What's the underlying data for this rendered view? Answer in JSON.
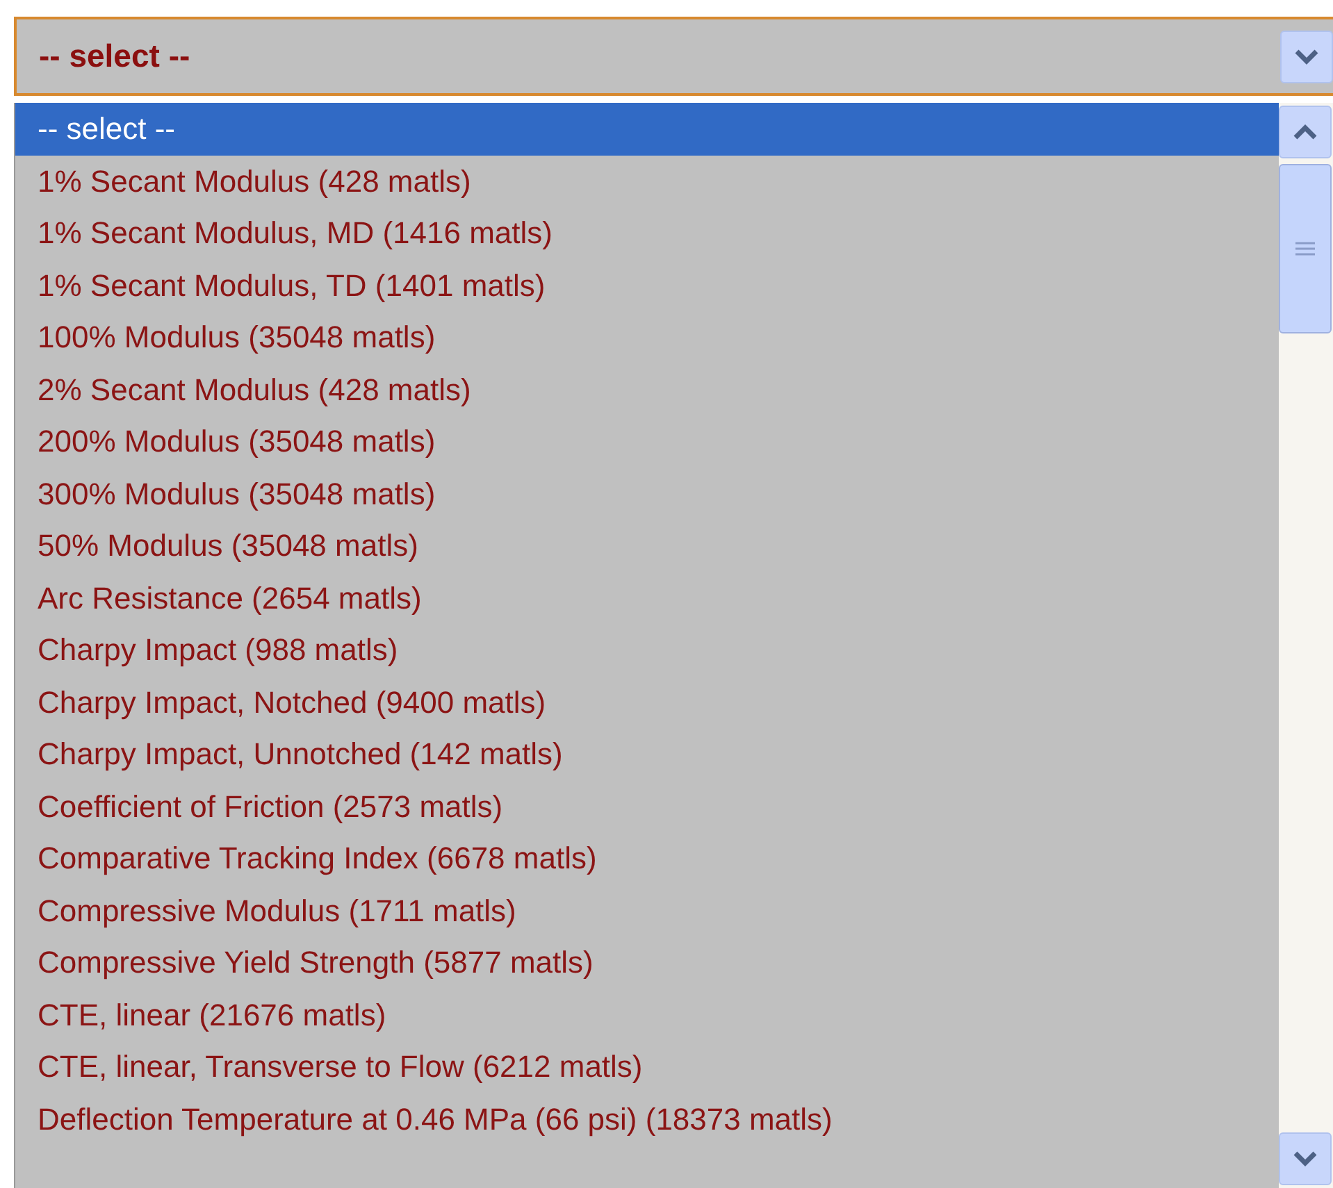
{
  "select": {
    "value": "-- select --"
  },
  "options": [
    {
      "label": "-- select --",
      "selected": true
    },
    {
      "label": "1% Secant Modulus (428 matls)",
      "selected": false
    },
    {
      "label": "1% Secant Modulus, MD (1416 matls)",
      "selected": false
    },
    {
      "label": "1% Secant Modulus, TD (1401 matls)",
      "selected": false
    },
    {
      "label": "100% Modulus (35048 matls)",
      "selected": false
    },
    {
      "label": "2% Secant Modulus (428 matls)",
      "selected": false
    },
    {
      "label": "200% Modulus (35048 matls)",
      "selected": false
    },
    {
      "label": "300% Modulus (35048 matls)",
      "selected": false
    },
    {
      "label": "50% Modulus (35048 matls)",
      "selected": false
    },
    {
      "label": "Arc Resistance (2654 matls)",
      "selected": false
    },
    {
      "label": "Charpy Impact (988 matls)",
      "selected": false
    },
    {
      "label": "Charpy Impact, Notched (9400 matls)",
      "selected": false
    },
    {
      "label": "Charpy Impact, Unnotched (142 matls)",
      "selected": false
    },
    {
      "label": "Coefficient of Friction (2573 matls)",
      "selected": false
    },
    {
      "label": "Comparative Tracking Index (6678 matls)",
      "selected": false
    },
    {
      "label": "Compressive Modulus (1711 matls)",
      "selected": false
    },
    {
      "label": "Compressive Yield Strength (5877 matls)",
      "selected": false
    },
    {
      "label": "CTE, linear (21676 matls)",
      "selected": false
    },
    {
      "label": "CTE, linear, Transverse to Flow (6212 matls)",
      "selected": false
    },
    {
      "label": "Deflection Temperature at 0.46 MPa (66 psi) (18373 matls)",
      "selected": false
    }
  ]
}
